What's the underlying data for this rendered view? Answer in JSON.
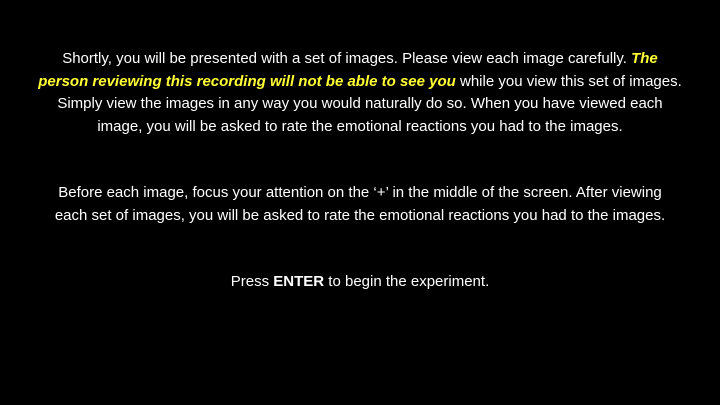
{
  "screen": {
    "background": "#000000",
    "text_color": "#ffffff",
    "highlight_color": "#ffff33"
  },
  "paragraph1": {
    "line1_start": "Shortly, you will be presented with a set of images. Please view each image carefully.",
    "line1_highlight": "The",
    "line2_highlight": "person reviewing this recording will not be able to see you",
    "line2_end": "while you view this set of images.",
    "line3": "Simply view the images in any way you would naturally do so. When you have viewed each",
    "line4": "image, you will be asked to rate the emotional reactions you had to the images."
  },
  "paragraph2": {
    "line1": "Before each image, focus your attention on the ‘+’ in the middle of the screen. After viewing",
    "line2": "each set of images, you will be asked to rate the emotional reactions you had to the images."
  },
  "paragraph3": {
    "prefix": "Press",
    "key": "ENTER",
    "suffix": "to begin the experiment."
  }
}
